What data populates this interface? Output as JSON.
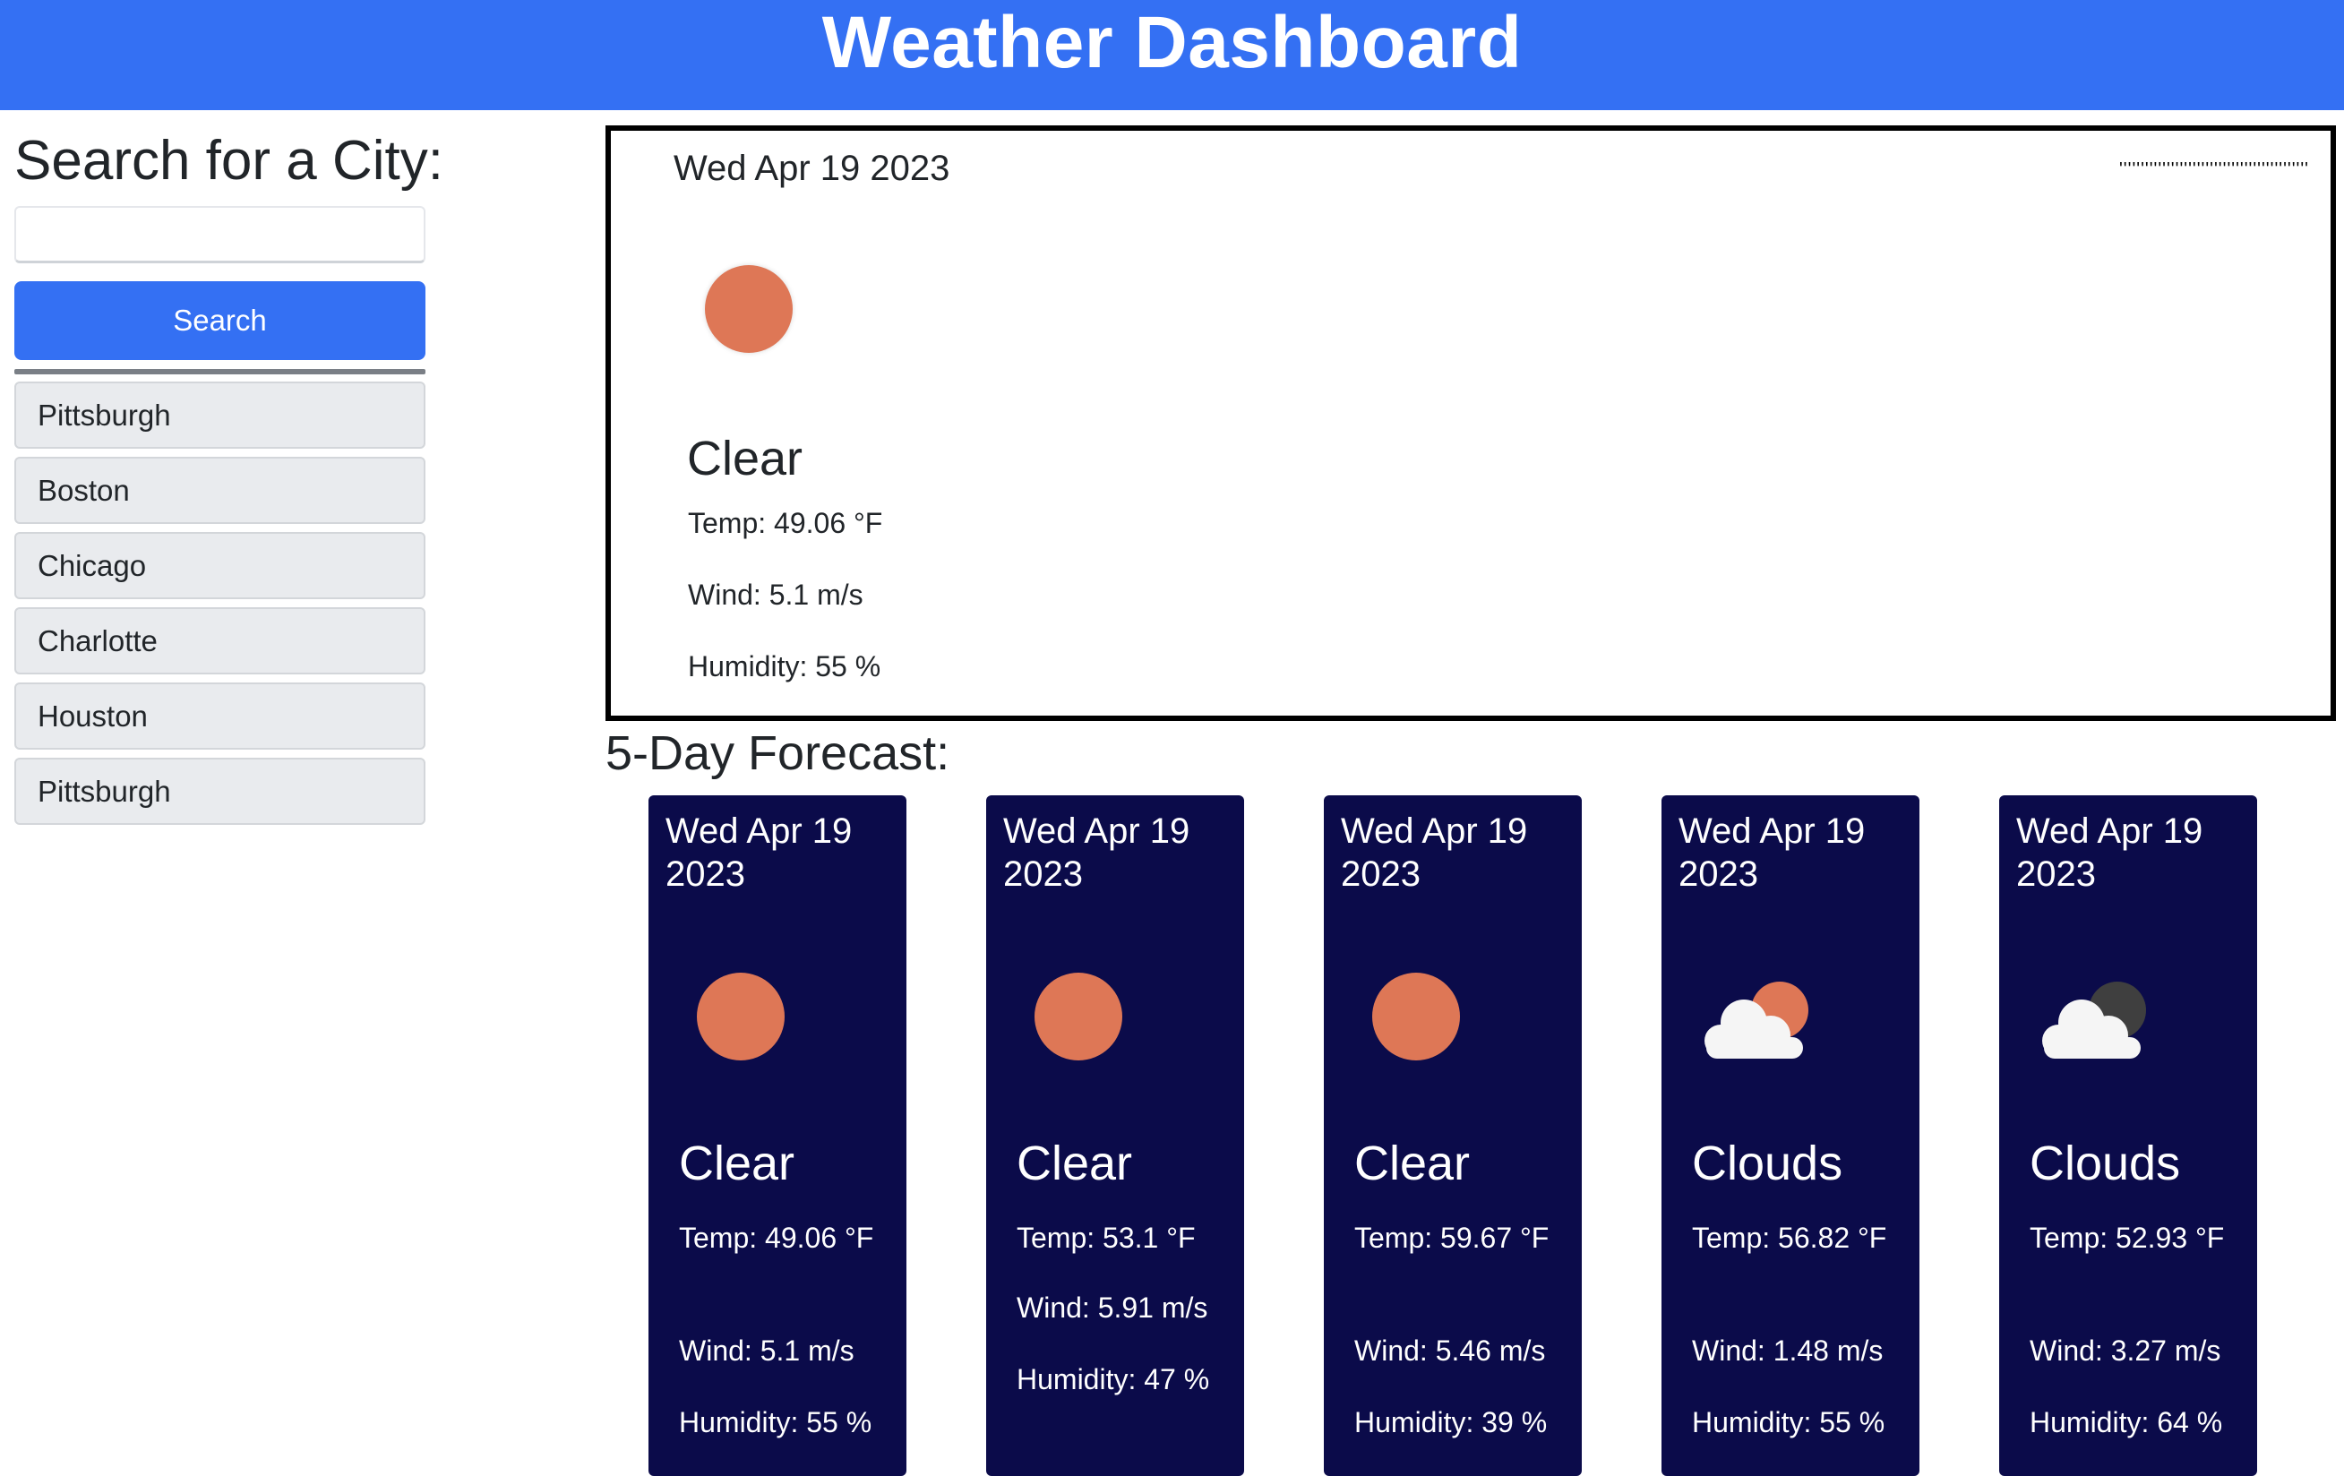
{
  "header": {
    "title": "Weather Dashboard"
  },
  "sidebar": {
    "heading": "Search for a City:",
    "search_value": "",
    "search_button": "Search",
    "history": [
      "Pittsburgh",
      "Boston",
      "Chicago",
      "Charlotte",
      "Houston",
      "Pittsburgh"
    ]
  },
  "current": {
    "date": "Wed Apr 19 2023",
    "ticks": "''''''''''''''''''''''''''''''''''''''''''''",
    "icon": "sun-icon",
    "condition": "Clear",
    "temp": "Temp: 49.06 °F",
    "wind": "Wind: 5.1 m/s",
    "humidity": "Humidity: 55 %"
  },
  "forecast": {
    "title": "5-Day Forecast:",
    "days": [
      {
        "date": "Wed Apr 19 2023",
        "icon": "sun-icon",
        "condition": "Clear",
        "temp": "Temp: 49.06 °F",
        "wind": "Wind: 5.1 m/s",
        "humidity": "Humidity: 55 %"
      },
      {
        "date": "Wed Apr 19 2023",
        "icon": "sun-icon",
        "condition": "Clear",
        "temp": "Temp: 53.1 °F",
        "wind": "Wind: 5.91 m/s",
        "humidity": "Humidity: 47 %"
      },
      {
        "date": "Wed Apr 19 2023",
        "icon": "sun-icon",
        "condition": "Clear",
        "temp": "Temp: 59.67 °F",
        "wind": "Wind: 5.46 m/s",
        "humidity": "Humidity: 39 %"
      },
      {
        "date": "Wed Apr 19 2023",
        "icon": "cloud-sun-icon",
        "condition": "Clouds",
        "temp": "Temp: 56.82 °F",
        "wind": "Wind: 1.48 m/s",
        "humidity": "Humidity: 55 %"
      },
      {
        "date": "Wed Apr 19 2023",
        "icon": "cloud-moon-icon",
        "condition": "Clouds",
        "temp": "Temp: 52.93 °F",
        "wind": "Wind: 3.27 m/s",
        "humidity": "Humidity: 64 %"
      }
    ]
  },
  "colors": {
    "brand": "#3470f3",
    "card_bg": "#0b0b4a",
    "sun": "#de7756",
    "moon": "#3f3f3f",
    "cloud": "#f5f5f5"
  }
}
